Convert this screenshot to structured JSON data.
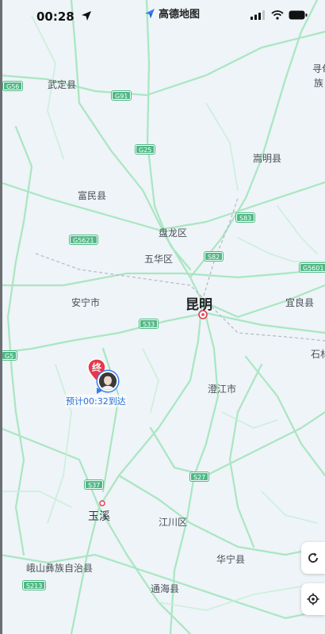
{
  "status_bar": {
    "time": "00:28",
    "brand": "高德地图"
  },
  "map": {
    "cities": {
      "kunming": "昆明",
      "yuxi": "玉溪"
    },
    "places": {
      "wuding": "武定县",
      "xundian": "寻甸",
      "xundian_zu": "族",
      "songming": "嵩明县",
      "fumin": "富民县",
      "panlong": "盘龙区",
      "wuhua": "五华区",
      "anning": "安宁市",
      "yiliang": "宜良县",
      "shilin": "石林",
      "chengjiang": "澄江市",
      "jiangchuan": "江川区",
      "eshan": "峨山彝族自治县",
      "huaning": "华宁县",
      "tonghai": "通海县"
    },
    "highways": {
      "g91": "G91",
      "g25": "G25",
      "g5621": "G5621",
      "s82": "S82",
      "g5601": "G5601",
      "s83": "S83",
      "s33": "S33",
      "s37": "S37",
      "s27": "S27",
      "s213": "S213",
      "g65": "G5",
      "g56": "G56"
    }
  },
  "destination": {
    "marker": "终",
    "eta_text": "预计00:32到达"
  },
  "controls": [
    "refresh-icon",
    "locate-icon"
  ],
  "colors": {
    "road": "#8fe0b0",
    "highway": "#4fb885",
    "destination": "#e8394a",
    "eta": "#2a6fd6"
  }
}
